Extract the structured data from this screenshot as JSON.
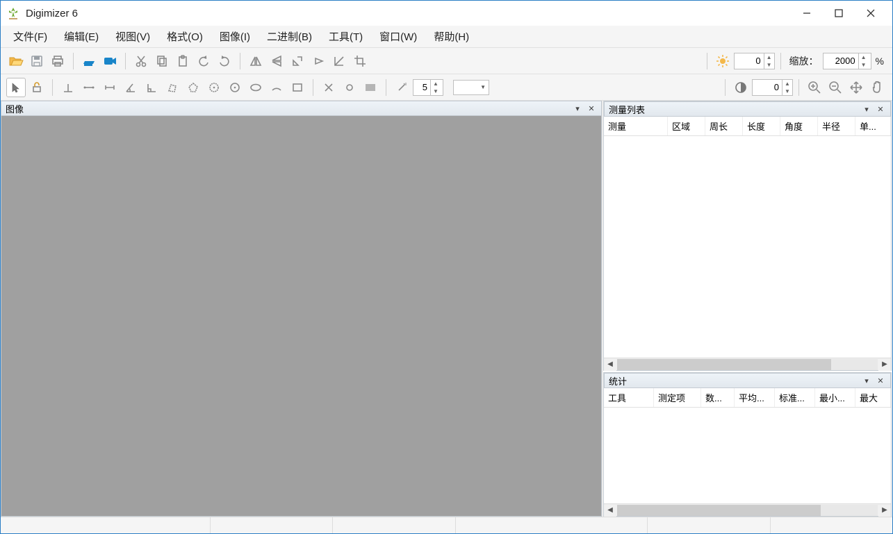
{
  "app": {
    "title": "Digimizer 6"
  },
  "menu": {
    "file": "文件(F)",
    "edit": "编辑(E)",
    "view": "视图(V)",
    "format": "格式(O)",
    "image": "图像(I)",
    "binary": "二进制(B)",
    "tools": "工具(T)",
    "window": "窗口(W)",
    "help": "帮助(H)"
  },
  "toolbar": {
    "brightness_value": "0",
    "contrast_value": "0",
    "zoom_label": "缩放：",
    "zoom_value": "2000",
    "zoom_unit": "%",
    "magic_value": "5"
  },
  "panels": {
    "image": {
      "title": "图像"
    },
    "measurements": {
      "title": "测量列表",
      "columns": {
        "c0": "测量",
        "c1": "区域",
        "c2": "周长",
        "c3": "长度",
        "c4": "角度",
        "c5": "半径",
        "c6": "单..."
      }
    },
    "stats": {
      "title": "统计",
      "columns": {
        "c0": "工具",
        "c1": "测定项",
        "c2": "数...",
        "c3": "平均...",
        "c4": "标准...",
        "c5": "最小...",
        "c6": "最大"
      }
    }
  }
}
